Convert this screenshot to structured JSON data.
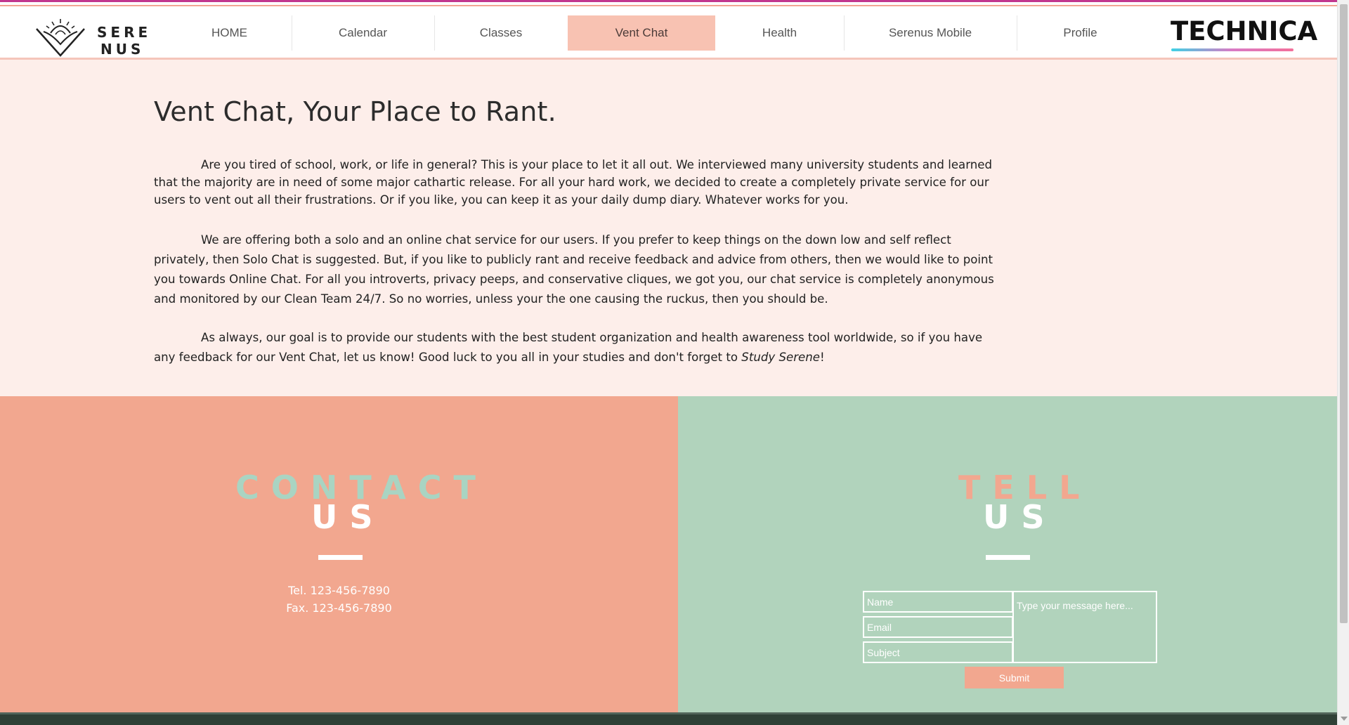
{
  "header": {
    "logo": {
      "line1": "SERE",
      "line2": "NUS"
    },
    "nav": [
      {
        "label": "HOME"
      },
      {
        "label": "Calendar"
      },
      {
        "label": "Classes"
      },
      {
        "label": "Vent Chat",
        "active": true
      },
      {
        "label": "Health"
      },
      {
        "label": "Serenus Mobile"
      },
      {
        "label": "Profile"
      }
    ],
    "sponsor": "TECHNICA"
  },
  "main": {
    "title": "Vent Chat, Your Place to Rant.",
    "paragraph1": "Are you tired of school, work, or life in general? This is your place to let it all out. We interviewed many university students and learned that the majority are in need of some major cathartic release. For all your hard work, we decided to create a completely private service for our users to vent out all their frustrations. Or if you like, you can keep it as your daily dump diary. Whatever works for you.",
    "paragraph2": "We are offering both a solo and an online chat service for our users. If you prefer to keep things on the down low and self reflect privately, then Solo Chat is suggested. But, if you like to publicly rant and receive feedback and advice from others, then we would like to point you towards Online Chat. For all you introverts, privacy peeps, and conservative cliques, we got you, our chat service is completely anonymous and monitored by our Clean Team 24/7. So no worries, unless your the one causing the ruckus, then you should be.",
    "paragraph3_text": "As always, our goal is to provide our students with the best student organization and health awareness tool worldwide, so if you have any feedback for our Vent Chat, let us know! Good luck to you all in your studies and don't forget to ",
    "paragraph3_emphasis": "Study Serene",
    "paragraph3_end": "!"
  },
  "contact": {
    "heading_line1": "CONTACT",
    "heading_line2": "US",
    "tel": "Tel. 123-456-7890",
    "fax": "Fax. 123-456-7890"
  },
  "tell": {
    "heading_line1": "TELL",
    "heading_line2": "US",
    "name_placeholder": "Name",
    "email_placeholder": "Email",
    "subject_placeholder": "Subject",
    "message_placeholder": "Type your message here...",
    "submit_label": "Submit"
  },
  "colors": {
    "accent_active": "#f8c2b2",
    "contact_bg": "#f2a78f",
    "tell_bg": "#b1d3bc",
    "page_bg": "#fdeeea"
  }
}
